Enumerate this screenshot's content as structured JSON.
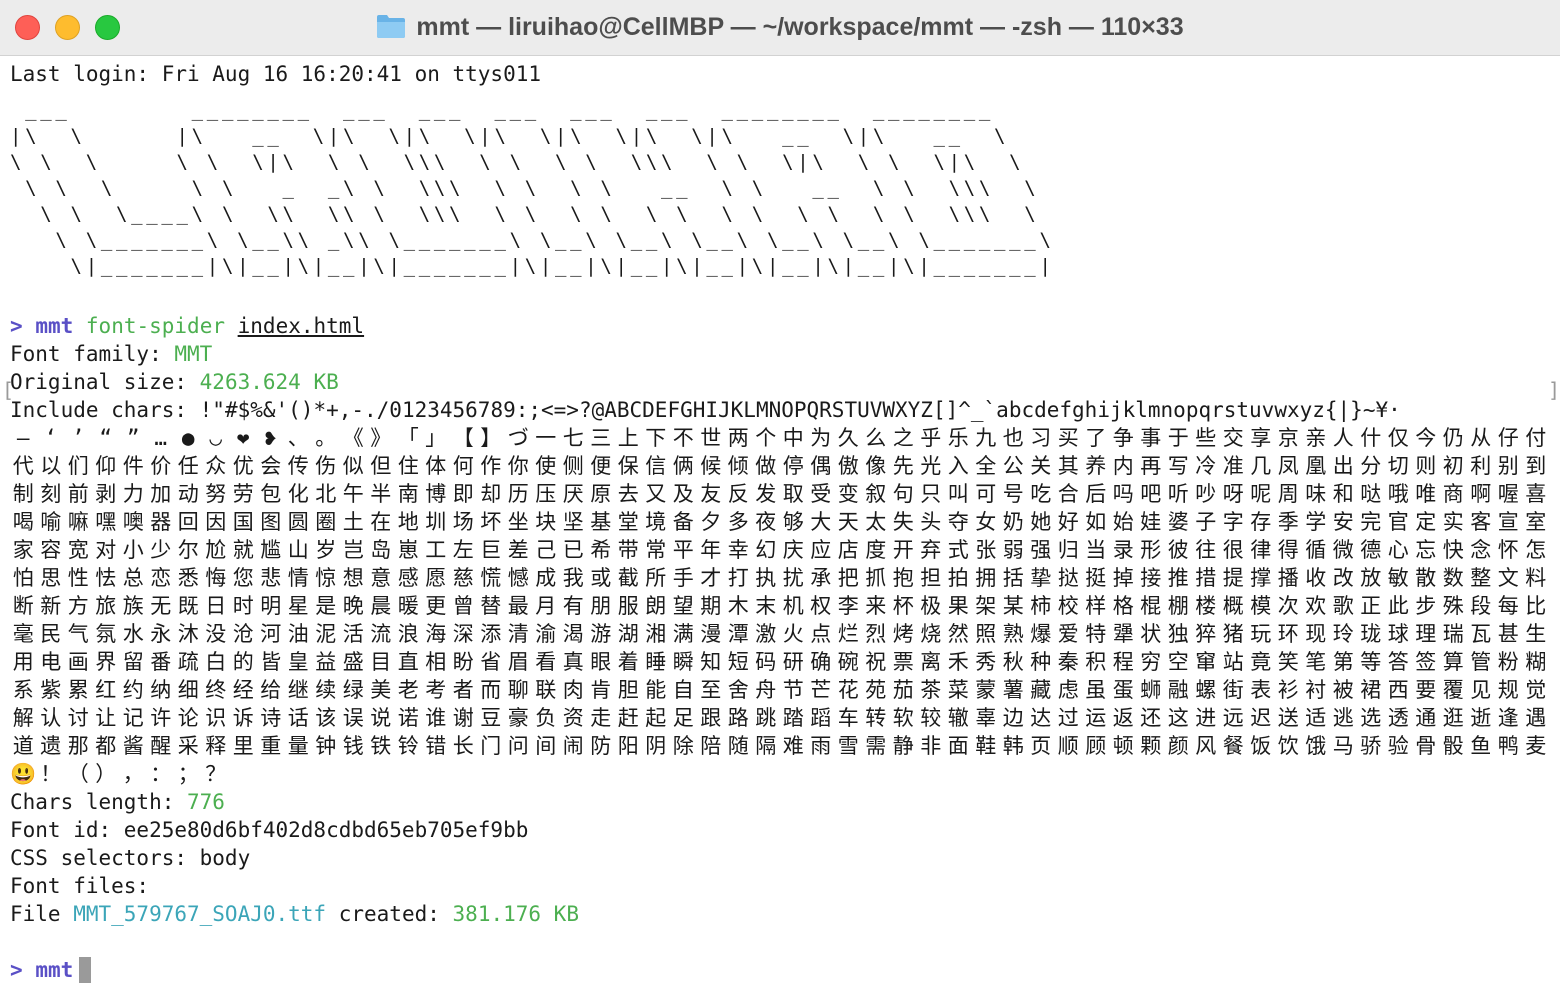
{
  "window": {
    "title": "mmt — liruihao@CellMBP — ~/workspace/mmt — -zsh — 110×33",
    "folder_icon": "folder-icon"
  },
  "terminal": {
    "last_login": "Last login: Fri Aug 16 16:20:41 on ttys011",
    "ascii_art": [
      " ___        ________  ___  ___  ___  ___  ___  ________  ________",
      "|\\  \\      |\\   __  \\|\\  \\|\\  \\|\\  \\|\\  \\|\\  \\|\\   __  \\|\\   __  \\",
      "\\ \\  \\     \\ \\  \\|\\  \\ \\  \\\\\\  \\ \\  \\ \\  \\\\\\  \\ \\  \\|\\  \\ \\  \\|\\  \\",
      " \\ \\  \\     \\ \\   _  _\\ \\  \\\\\\  \\ \\  \\ \\   __  \\ \\   __  \\ \\  \\\\\\  \\",
      "  \\ \\  \\____\\ \\  \\\\  \\\\ \\  \\\\\\  \\ \\  \\ \\  \\ \\  \\ \\  \\ \\  \\ \\  \\\\\\  \\",
      "   \\ \\_______\\ \\__\\\\ _\\\\ \\_______\\ \\__\\ \\__\\ \\__\\ \\__\\ \\__\\ \\_______\\",
      "    \\|_______|\\|__|\\|__|\\|_______|\\|__|\\|__|\\|__|\\|__|\\|__|\\|_______|"
    ],
    "prompt_symbol": ">",
    "prompt_dir": "mmt",
    "command": "font-spider",
    "command_arg": "index.html",
    "font_family_label": "Font family: ",
    "font_family_value": "MMT",
    "original_size_label": "Original size: ",
    "original_size_value": "4263.624 KB",
    "include_chars_label": "Include chars: ",
    "include_chars_ascii": "!\"#$%&'()*+,-./0123456789:;<=>?@ABCDEFGHIJKLMNOPQRSTUVWXYZ[]^_`abcdefghijklmnopqrstuvwxyz{|}~¥·",
    "include_chars_cjk": "—‘’“”…●◡❤❥、。《》「」【】づ一七三上下不世两个中为久么之乎乐九也习买了争事于些交享京亲人什仅今仍从仔付代以们仰件价任众优会传伤似但住体何作你使侧便保信俩候倾做停偶傲像先光入全公关其养内再写冷准几凤凰出分切则初利别到制刻前剥力加动努劳包化北午半南博即却历压厌原去又及友反发取受变叙句只叫可号吃合后吗吧听吵呀呢周味和哒哦唯商啊喔喜喝喻嘛嘿噢器回因国图圆圈土在地圳场坏坐块坚基堂境备夕多夜够大天太失头夺女奶她好如始娃婆子字存季学安完官定实客宣室家容宽对小少尔尬就尴山岁岂岛崽工左巨差己已希带常平年幸幻庆应店度开弃式张弱强归当录形彼往很律得循微德心忘快念怀怎怕思性怯总恋悉悔您悲情惊想意感愿慈慌憾成我或截所手才打执扰承把抓抱担拍拥括挚挞挺掉接推措提撑播收改放敏散数整文料断新方旅族无既日时明星是晚晨暖更曾替最月有朋服朗望期木末机权李来杯极果架某柿校样格棍棚楼概模次欢歌正此步殊段每比毫民气氛水永沐没沧河油泥活流浪海深添清渝渴游湖湘满漫潭激火点烂烈烤烧然照熟爆爱特犟状独猝猪玩环现玲珑球理瑞瓦甚生用电画界留番疏白的皆皇益盛目直相盼省眉看真眼着睡瞬知短码研确碗祝票离禾秀秋种秦积程穷空窜站竟笑笔第等答签算管粉糊系紫累红约纳细终经给继续绿美老考者而聊联肉肯胆能自至舍舟节芒花苑茄茶菜蒙薯藏虑虽蛋蛳融螺街表衫衬被裙西要覆见规觉解认讨让记许论识诉诗话该误说诺谁谢豆豪负资走赶起足跟路跳踏蹈车转软较辙辜边达过运返还这进远迟送适逃选透通逛逝逢遇道遗那都酱醒采释里重量钟钱铁铃错长门问间闹防阳阴除陪随隔难雨雪需静非面鞋韩页顺顾顿颗颜风餐饭饮饿马骄验骨骰鱼鸭麦😃！（），：；？",
    "chars_length_label": "Chars length: ",
    "chars_length_value": "776",
    "font_id_line": "Font id: ee25e80d6bf402d8cdbd65eb705ef9bb",
    "css_selectors_line": "CSS selectors: body",
    "font_files_line": "Font files:",
    "file_label": "File ",
    "file_name": "MMT_579767_SOAJ0.ttf",
    "file_created": " created: ",
    "file_size": "381.176 KB",
    "mark_left": "[",
    "mark_right": "]"
  },
  "colors": {
    "green": "#4caf50",
    "prompt_purple": "#5a50c6",
    "cyan": "#3ba5b8"
  }
}
